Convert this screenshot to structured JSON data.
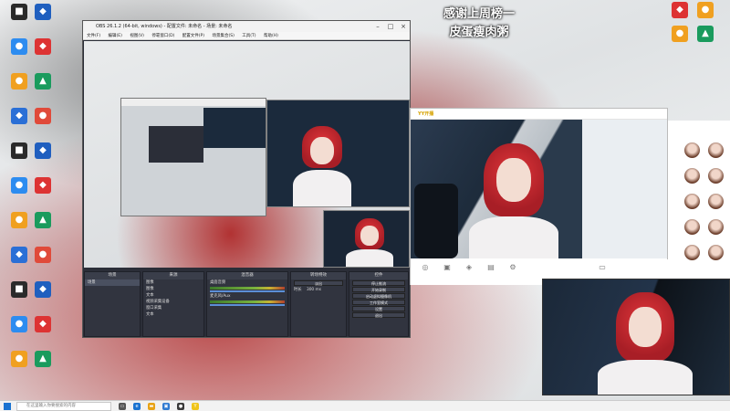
{
  "desktop": {
    "overlay_line1": "感谢上周榜一",
    "overlay_line2": "皮蛋瘦肉粥",
    "left_icons": [
      {
        "label": "",
        "color": "#2a2a2a",
        "glyph": "■"
      },
      {
        "label": "",
        "color": "#1f5fbf",
        "glyph": "◆"
      },
      {
        "label": "",
        "color": "#2d8cf0",
        "glyph": "●"
      },
      {
        "label": "",
        "color": "#d33",
        "glyph": "◆"
      },
      {
        "label": "",
        "color": "#f0a020",
        "glyph": "●"
      },
      {
        "label": "",
        "color": "#1a9b5d",
        "glyph": "▲"
      },
      {
        "label": "",
        "color": "#2a6fd6",
        "glyph": "◆"
      },
      {
        "label": "",
        "color": "#e04a3a",
        "glyph": "●"
      }
    ],
    "notes": [
      "",
      "",
      "",
      "",
      ""
    ]
  },
  "obs": {
    "title": "OBS 26.1.2 (64-bit, windows) - 配置文件: 未命名 - 场景: 未命名",
    "menu": [
      "文件(F)",
      "编辑(E)",
      "视图(V)",
      "停靠窗口(D)",
      "配置文件(P)",
      "场景集合(S)",
      "工具(T)",
      "帮助(H)"
    ],
    "docks": {
      "scenes_header": "场景",
      "scenes": [
        "场景"
      ],
      "sources_header": "来源",
      "sources": [
        "图像",
        "图像",
        "文本",
        "视频采集设备",
        "窗口采集",
        "文本"
      ],
      "mixer_header": "混音器",
      "mixer_tracks": [
        "桌面音频",
        "麦克风/Aux"
      ],
      "transitions_header": "转场特效",
      "transition_selected": "淡出",
      "duration_label": "时长",
      "duration_value": "300 ms",
      "controls_header": "控件",
      "controls": [
        "停止推流",
        "开始录制",
        "启动虚拟摄像机",
        "工作室模式",
        "设置",
        "退出"
      ]
    }
  },
  "yy": {
    "brand": "YY开播",
    "header_text": "",
    "chat_lines": [
      "",
      "",
      ""
    ],
    "tools": [
      "",
      "",
      "",
      "",
      ""
    ]
  },
  "taskbar": {
    "search_placeholder": "在这里输入你要搜索的内容",
    "time": "",
    "date": ""
  }
}
